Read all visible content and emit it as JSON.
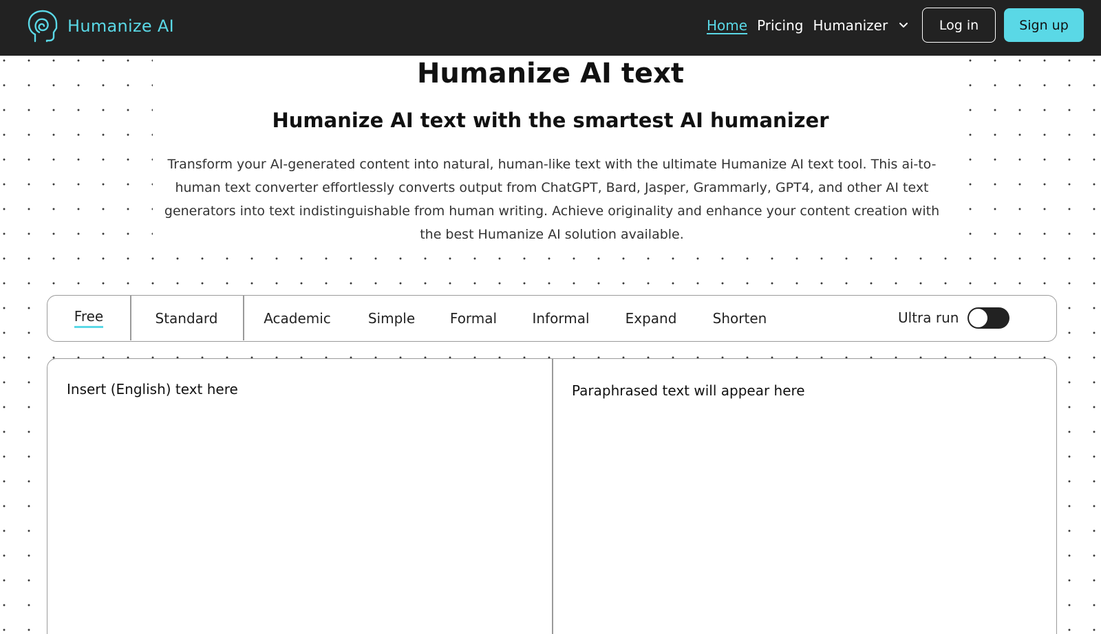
{
  "brand": {
    "name": "Humanize AI"
  },
  "nav": {
    "home": "Home",
    "pricing": "Pricing",
    "humanizer": "Humanizer",
    "login": "Log in",
    "signup": "Sign up"
  },
  "hero": {
    "title": "Humanize AI text",
    "subtitle": "Humanize AI text with the smartest AI humanizer",
    "description": "Transform your AI-generated content into natural, human-like text with the ultimate Humanize AI text tool. This ai-to-human text converter effortlessly converts output from ChatGPT, Bard, Jasper, Grammarly, GPT4, and other AI text generators into text indistinguishable from human writing. Achieve originality and enhance your content creation with the best Humanize AI solution available."
  },
  "modes": {
    "tabs": [
      "Free",
      "Standard",
      "Academic",
      "Simple",
      "Formal",
      "Informal",
      "Expand",
      "Shorten"
    ],
    "selected": "Free",
    "ultra_label": "Ultra run",
    "ultra_on": false
  },
  "editor": {
    "input_placeholder": "Insert (English) text here",
    "input_value": "",
    "output_placeholder": "Paraphrased text will appear here"
  },
  "colors": {
    "accent": "#5ad8e6",
    "navbar": "#222222",
    "border": "#9a9a9a"
  },
  "icons": {
    "logo": "head-spiral-icon",
    "dropdown": "chevron-down-icon"
  }
}
